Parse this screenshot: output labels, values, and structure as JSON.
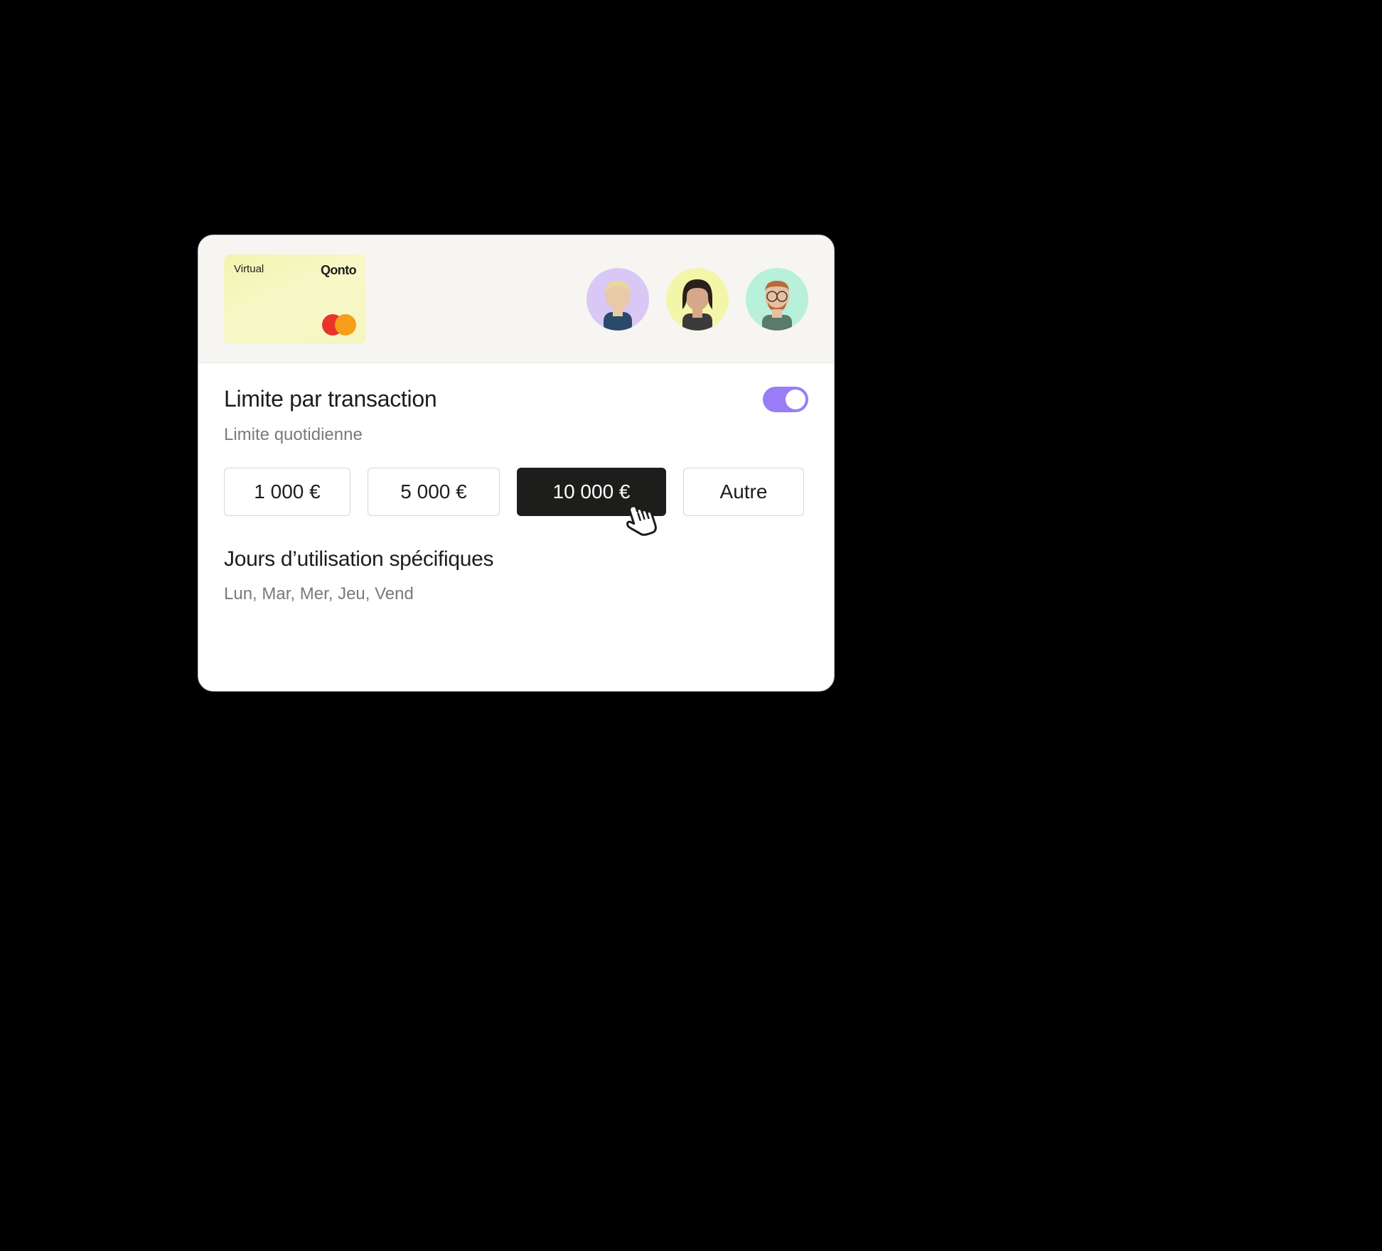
{
  "card": {
    "type_label": "Virtual",
    "brand": "Qonto"
  },
  "header": {
    "avatars": [
      {
        "bg": "avatar-bg-1"
      },
      {
        "bg": "avatar-bg-2"
      },
      {
        "bg": "avatar-bg-3"
      }
    ]
  },
  "transaction_limit": {
    "title": "Limite par transaction",
    "toggle_on": true,
    "sublabel": "Limite quotidienne",
    "amounts": [
      {
        "label": "1 000 €",
        "selected": false
      },
      {
        "label": "5 000 €",
        "selected": false
      },
      {
        "label": "10 000 €",
        "selected": true
      },
      {
        "label": "Autre",
        "selected": false
      }
    ]
  },
  "usage_days": {
    "title": "Jours d’utilisation spécifiques",
    "days_text": "Lun, Mar, Mer, Jeu, Vend"
  },
  "colors": {
    "accent": "#9b7cf7",
    "panel_bg": "#ffffff",
    "header_bg": "#f7f5f2"
  }
}
